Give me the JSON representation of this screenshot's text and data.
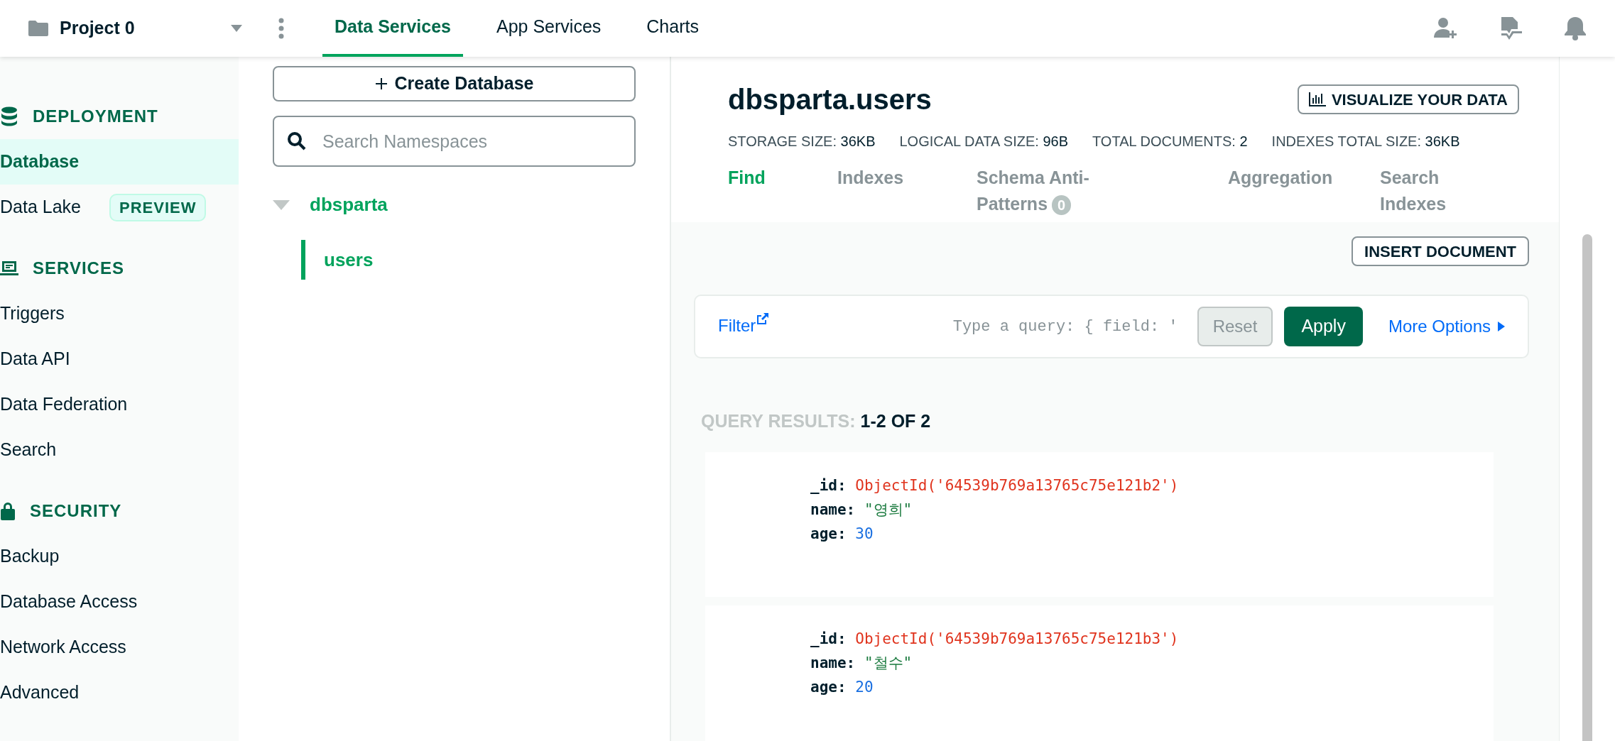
{
  "topbar": {
    "project": "Project 0",
    "tabs": [
      {
        "label": "Data Services",
        "selected": true
      },
      {
        "label": "App Services",
        "selected": false
      },
      {
        "label": "Charts",
        "selected": false
      }
    ]
  },
  "sidebar": {
    "sections": [
      {
        "title": "DEPLOYMENT",
        "kind": "database",
        "items": [
          {
            "label": "Database",
            "selected": true
          },
          {
            "label": "Data Lake",
            "selected": false,
            "badge": "PREVIEW"
          }
        ]
      },
      {
        "title": "SERVICES",
        "kind": "services",
        "items": [
          {
            "label": "Triggers",
            "selected": false
          },
          {
            "label": "Data API",
            "selected": false
          },
          {
            "label": "Data Federation",
            "selected": false
          },
          {
            "label": "Search",
            "selected": false
          }
        ]
      },
      {
        "title": "SECURITY",
        "kind": "lock",
        "items": [
          {
            "label": "Backup",
            "selected": false
          },
          {
            "label": "Database Access",
            "selected": false
          },
          {
            "label": "Network Access",
            "selected": false
          },
          {
            "label": "Advanced",
            "selected": false
          }
        ]
      }
    ]
  },
  "namespaces": {
    "create_button": "Create Database",
    "search": {
      "placeholder": "Search Namespaces"
    },
    "tree": [
      {
        "label": "dbsparta",
        "expanded": true,
        "children": [
          {
            "label": "users",
            "selected": true
          }
        ]
      }
    ]
  },
  "collection": {
    "title": "dbsparta.users",
    "visualize_button": "VISUALIZE YOUR DATA",
    "stats": [
      {
        "label": "STORAGE SIZE:",
        "value": "36KB"
      },
      {
        "label": "LOGICAL DATA SIZE:",
        "value": "96B"
      },
      {
        "label": "TOTAL DOCUMENTS:",
        "value": "2"
      },
      {
        "label": "INDEXES TOTAL SIZE:",
        "value": "36KB"
      }
    ],
    "tabs": [
      {
        "label": "Find",
        "selected": true
      },
      {
        "label": "Indexes",
        "selected": false
      },
      {
        "label": "Schema Anti-Patterns",
        "selected": false,
        "count": "0"
      },
      {
        "label": "Aggregation",
        "selected": false
      },
      {
        "label": "Search Indexes",
        "selected": false
      }
    ],
    "insert_button": "INSERT DOCUMENT",
    "filter": {
      "label": "Filter",
      "placeholder": "Type a query: { field: '",
      "reset": "Reset",
      "apply": "Apply",
      "more": "More Options"
    },
    "results": {
      "label": "QUERY RESULTS:",
      "range": "1-2 OF 2"
    },
    "documents": [
      {
        "fields": [
          {
            "key": "_id:",
            "value": "ObjectId('64539b769a13765c75e121b2')",
            "kind": "objectid"
          },
          {
            "key": "name:",
            "value": "\"영희\"",
            "kind": "string"
          },
          {
            "key": "age:",
            "value": "30",
            "kind": "number"
          }
        ]
      },
      {
        "fields": [
          {
            "key": "_id:",
            "value": "ObjectId('64539b769a13765c75e121b3')",
            "kind": "objectid"
          },
          {
            "key": "name:",
            "value": "\"철수\"",
            "kind": "string"
          },
          {
            "key": "age:",
            "value": "20",
            "kind": "number"
          }
        ]
      }
    ]
  }
}
